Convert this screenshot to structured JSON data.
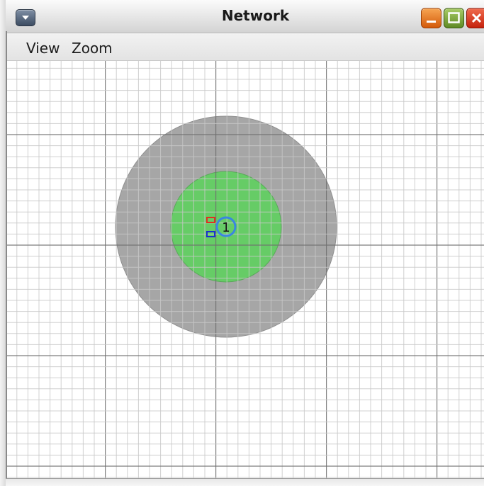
{
  "window": {
    "title": "Network"
  },
  "titlebar": {
    "menu_icon": "chevron-down-icon",
    "buttons": {
      "minimize_icon": "minimize-icon",
      "maximize_icon": "maximize-icon",
      "close_icon": "close-icon"
    }
  },
  "menubar": {
    "items": [
      {
        "label": "View"
      },
      {
        "label": "Zoom"
      }
    ]
  },
  "canvas": {
    "grid": true,
    "node": {
      "label": "1"
    },
    "colors": {
      "outer_range": "#a6a6a6",
      "inner_range": "#66cc66",
      "node_ring": "#3a86e0",
      "marker_red": "#e03020",
      "marker_blue": "#1a2fd0",
      "grid_minor": "#c8c8c8",
      "grid_major": "#707070"
    }
  }
}
